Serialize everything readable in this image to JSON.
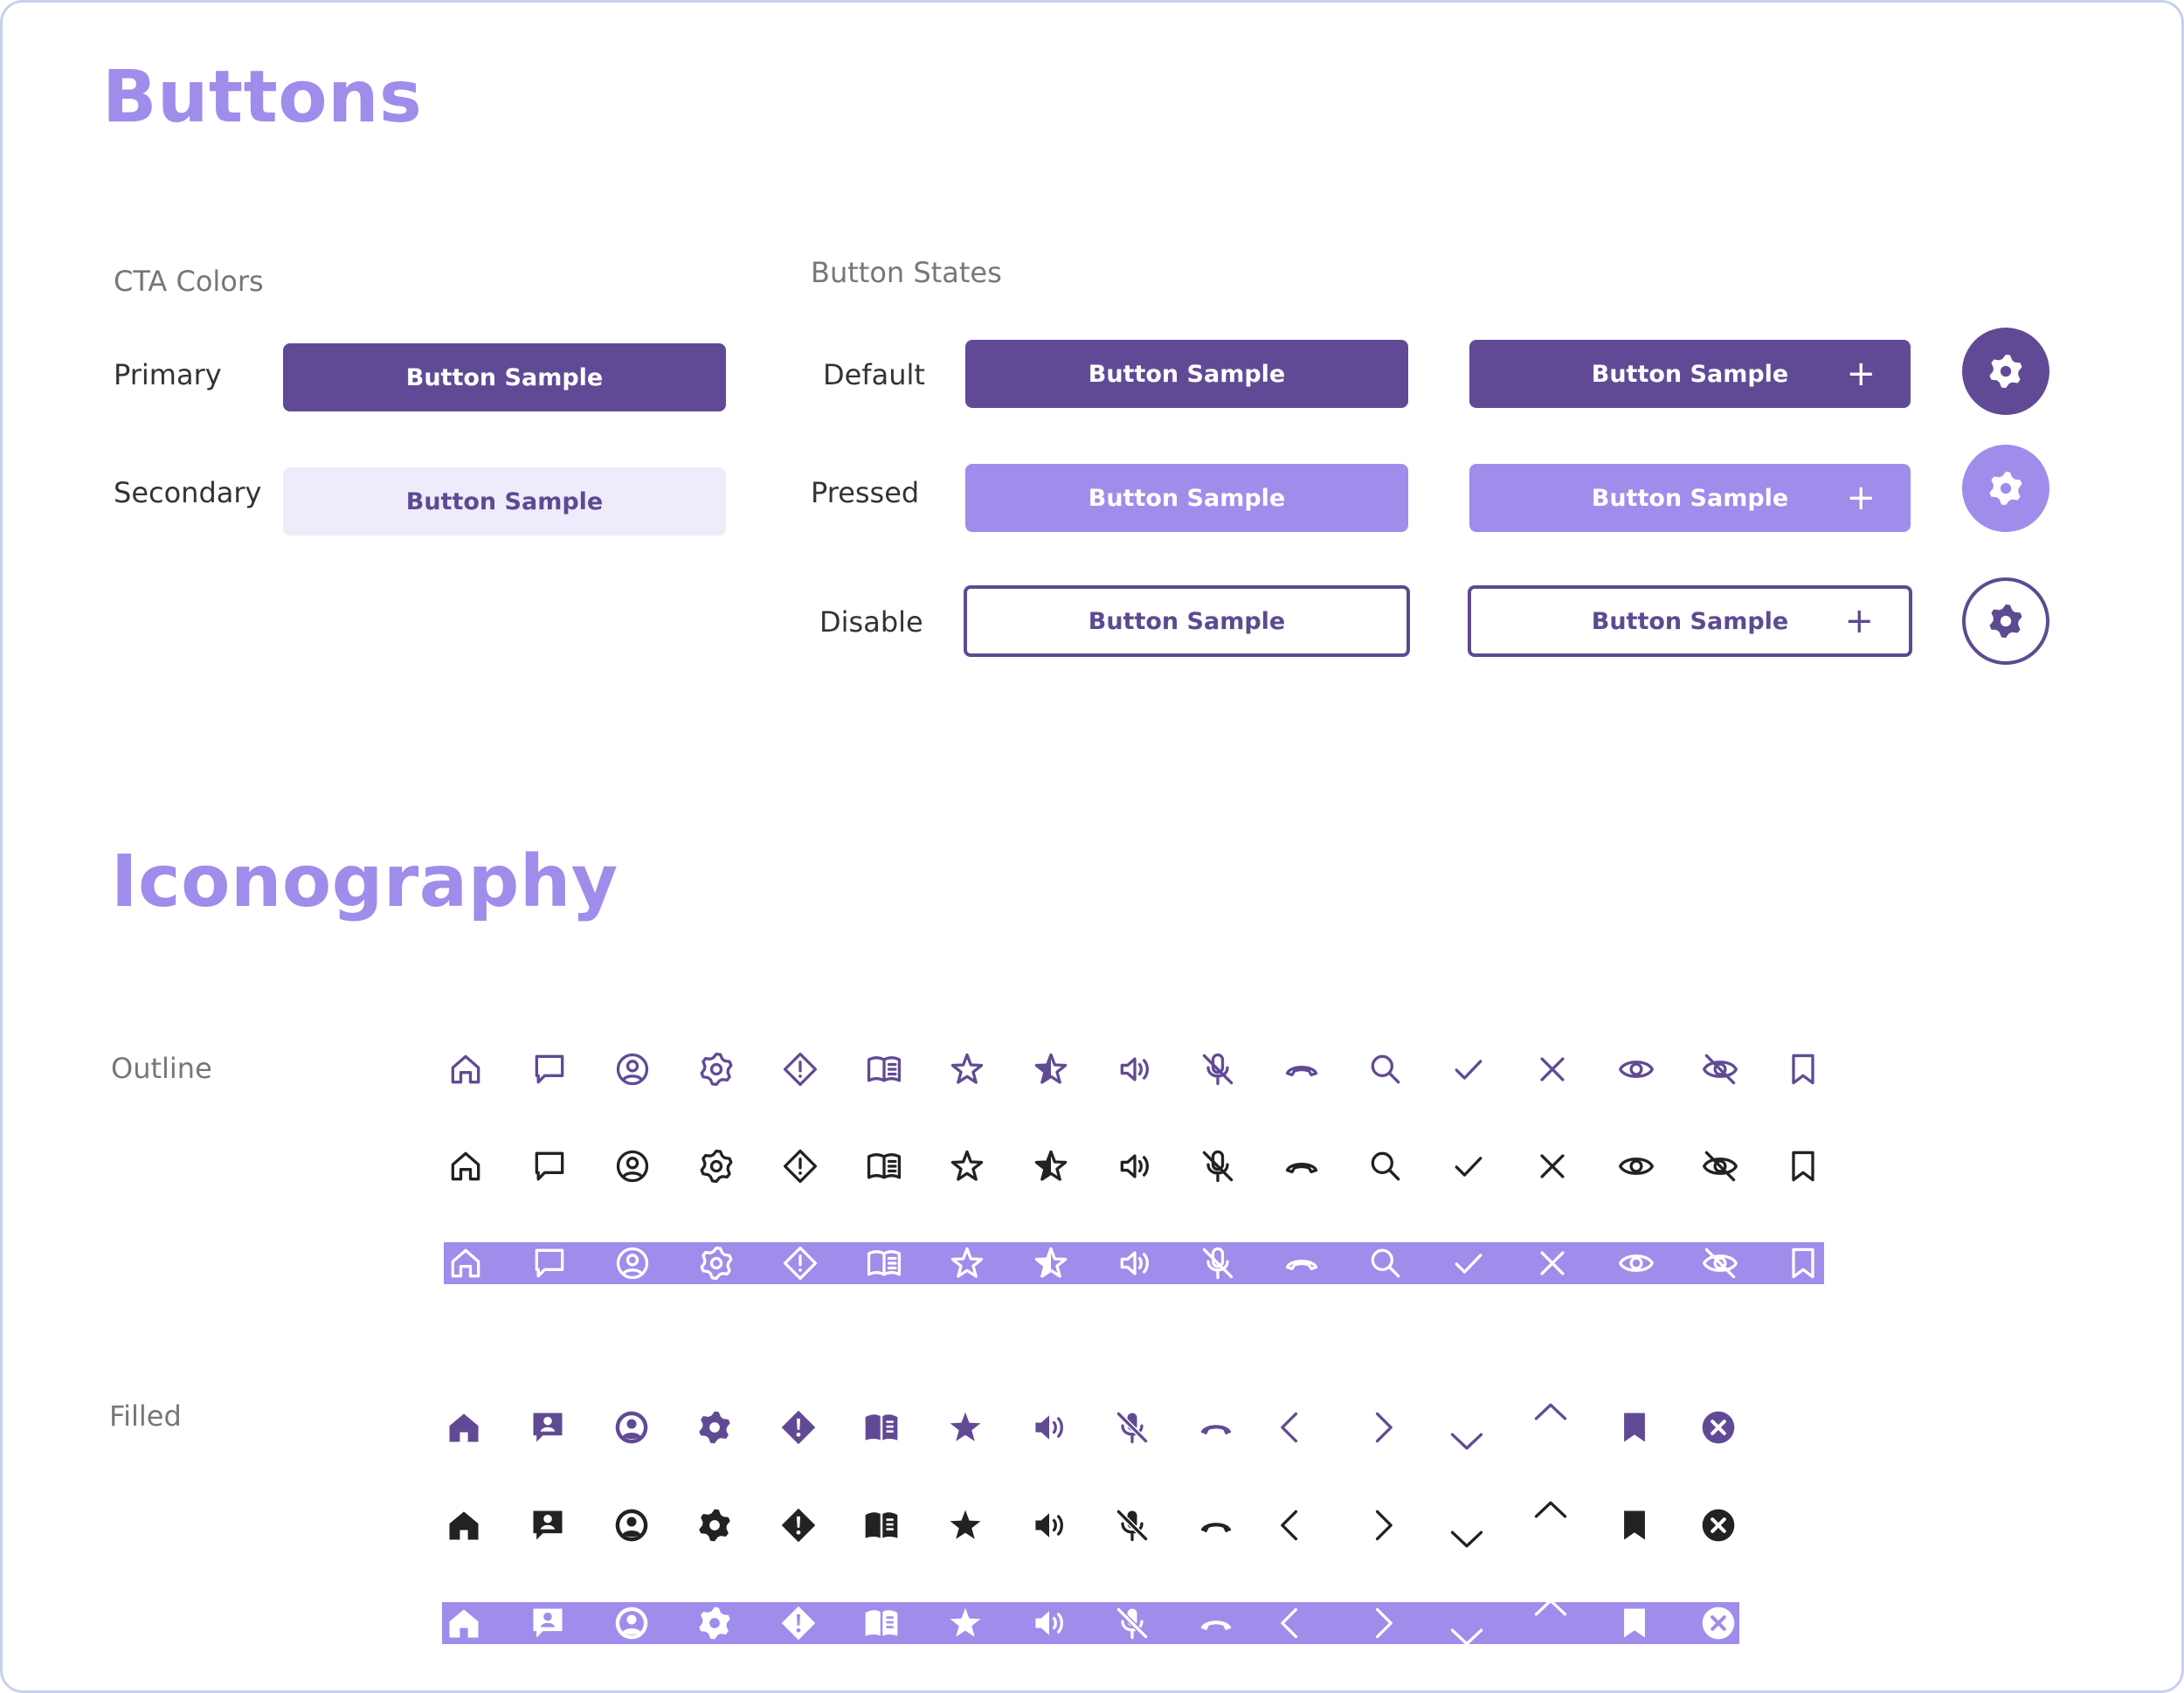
{
  "buttons_section": {
    "title": "Buttons",
    "cta_colors": {
      "heading": "CTA Colors",
      "primary_label": "Primary",
      "secondary_label": "Secondary",
      "primary_button": "Button Sample",
      "secondary_button": "Button Sample"
    },
    "button_states": {
      "heading": "Button States",
      "default_label": "Default",
      "pressed_label": "Pressed",
      "disable_label": "Disable",
      "button_text": "Button Sample",
      "plus_glyph": "+",
      "circle_icon": "gear-icon"
    }
  },
  "iconography_section": {
    "title": "Iconography",
    "outline_label": "Outline",
    "filled_label": "Filled",
    "outline_icons": [
      "home",
      "chat",
      "user-circle",
      "gear",
      "warning-diamond",
      "book",
      "star",
      "star-half",
      "volume",
      "mic-off",
      "phone-hangup",
      "search",
      "check",
      "close",
      "eye",
      "eye-off",
      "bookmark"
    ],
    "filled_icons": [
      "home",
      "contact-card",
      "user-circle",
      "gear",
      "warning-diamond",
      "book",
      "star",
      "volume",
      "mic-off",
      "phone-hangup",
      "chevron-left",
      "chevron-right",
      "chevron-down",
      "chevron-up",
      "bookmark",
      "close-circle"
    ]
  },
  "colors": {
    "heading": "#9f8ceb",
    "primary": "#614a95",
    "pressed": "#9f8ceb",
    "secondary_bg": "#eeebfb",
    "icon_dark": "#222222",
    "border": "#c9d0ee"
  }
}
